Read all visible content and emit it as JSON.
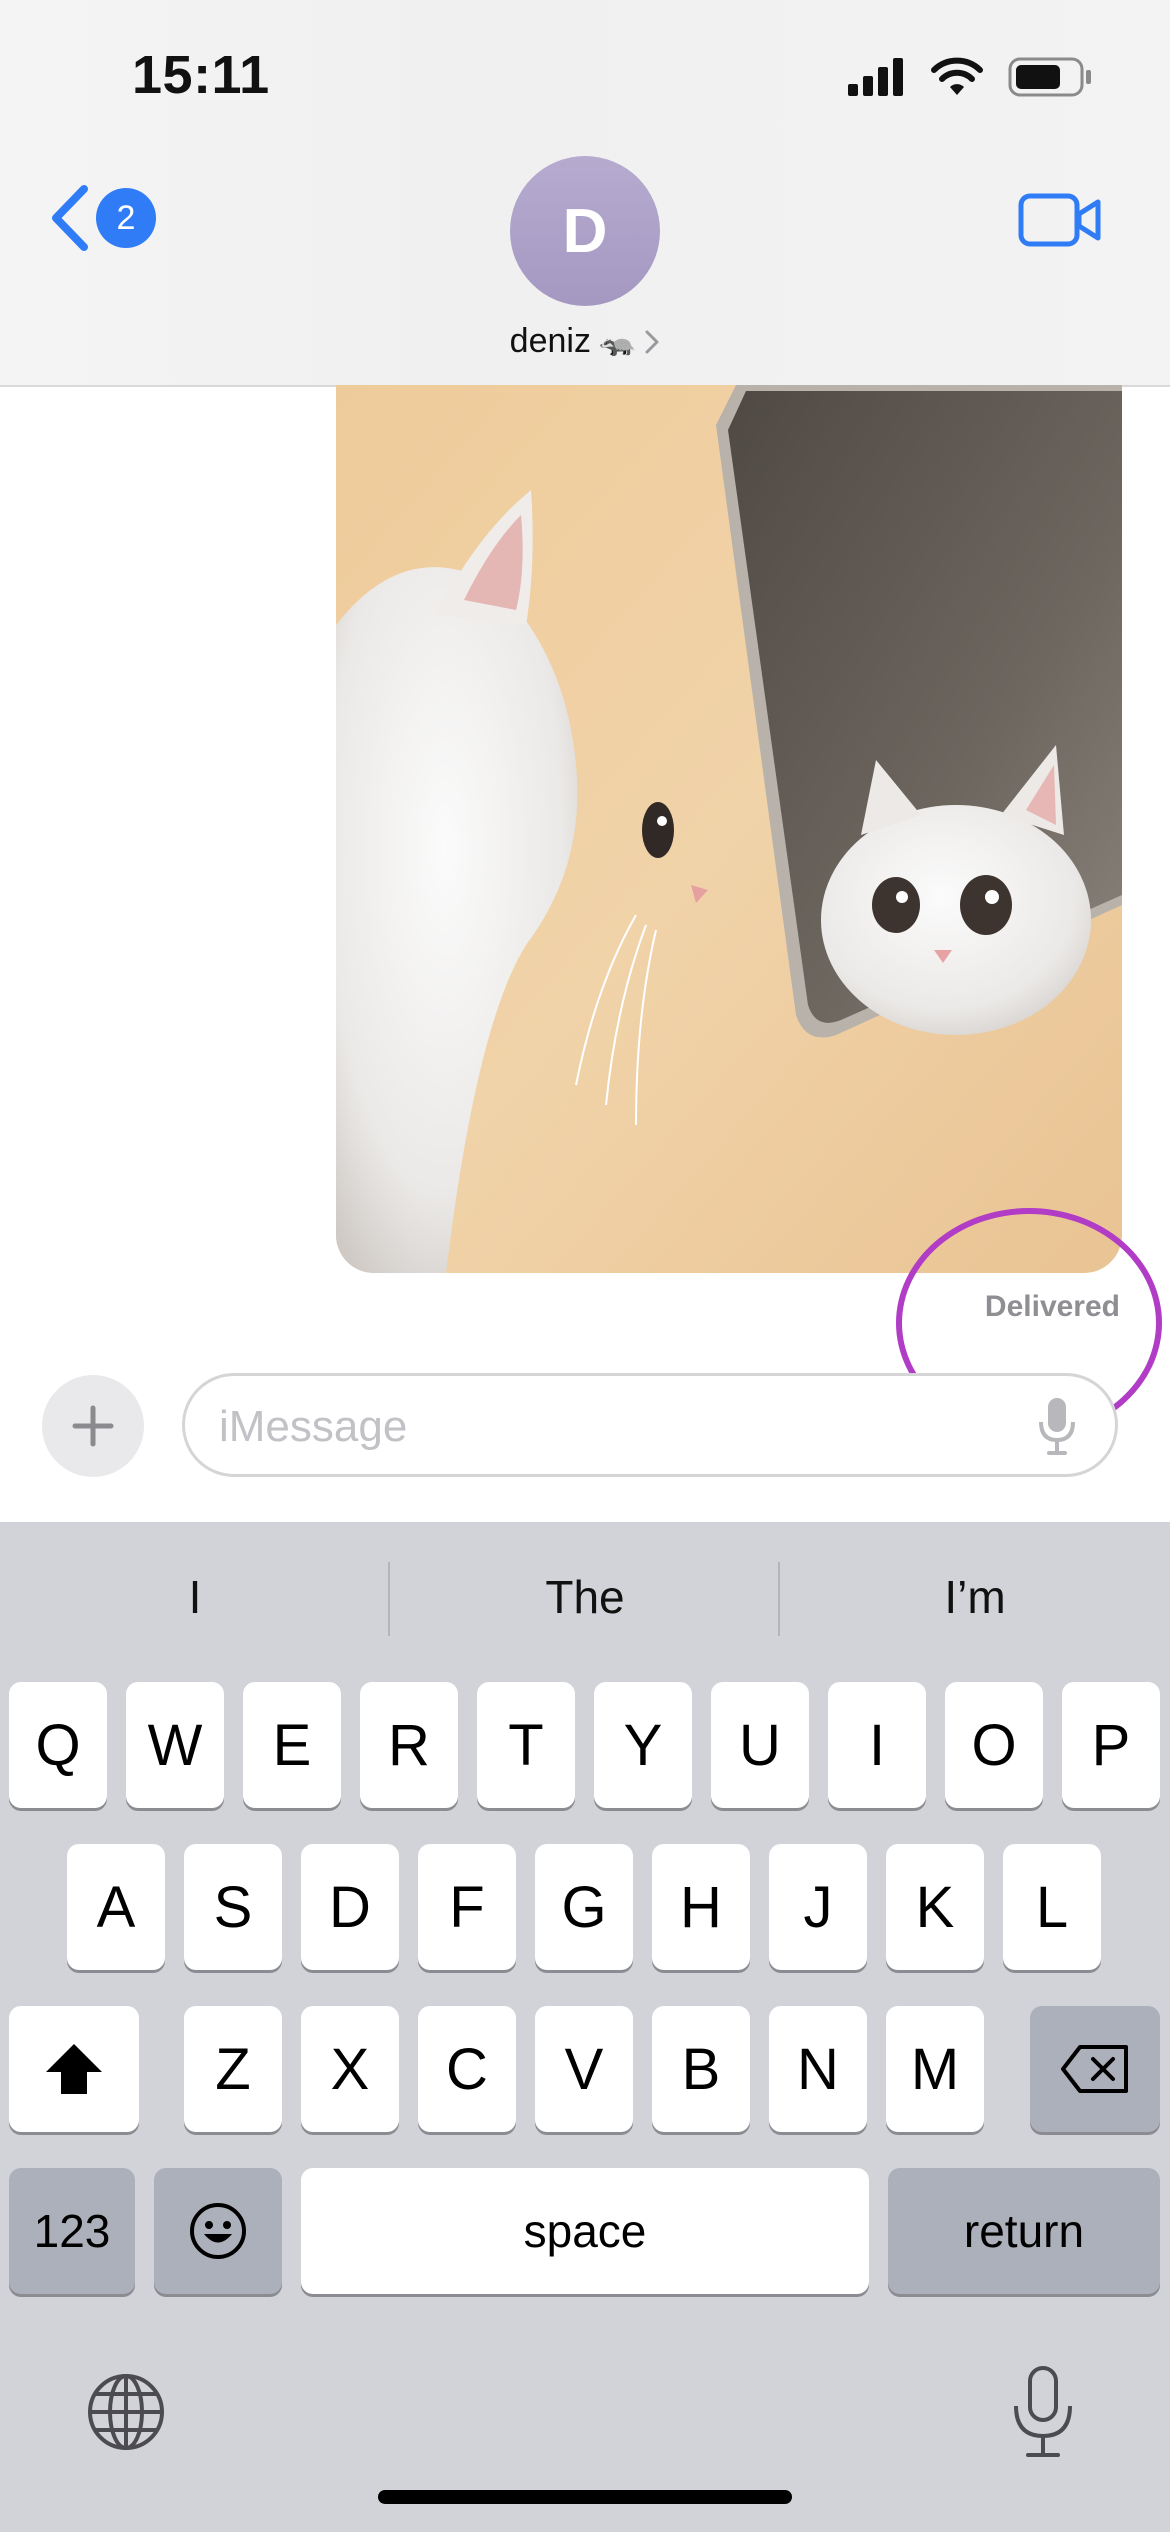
{
  "status_bar": {
    "time": "15:11"
  },
  "header": {
    "back_badge": "2",
    "avatar_initial": "D",
    "contact_name": "deniz",
    "contact_emoji": "🦡"
  },
  "conversation": {
    "delivery_status": "Delivered"
  },
  "input": {
    "placeholder": "iMessage"
  },
  "keyboard": {
    "suggestions": [
      "I",
      "The",
      "I’m"
    ],
    "row1": [
      "Q",
      "W",
      "E",
      "R",
      "T",
      "Y",
      "U",
      "I",
      "O",
      "P"
    ],
    "row2": [
      "A",
      "S",
      "D",
      "F",
      "G",
      "H",
      "J",
      "K",
      "L"
    ],
    "row3": [
      "Z",
      "X",
      "C",
      "V",
      "B",
      "N",
      "M"
    ],
    "numbers_label": "123",
    "space_label": "space",
    "return_label": "return"
  },
  "colors": {
    "accent_blue": "#2f7cf6",
    "annotation_magenta": "#b13cc6",
    "keyboard_bg": "#d1d3d9"
  }
}
